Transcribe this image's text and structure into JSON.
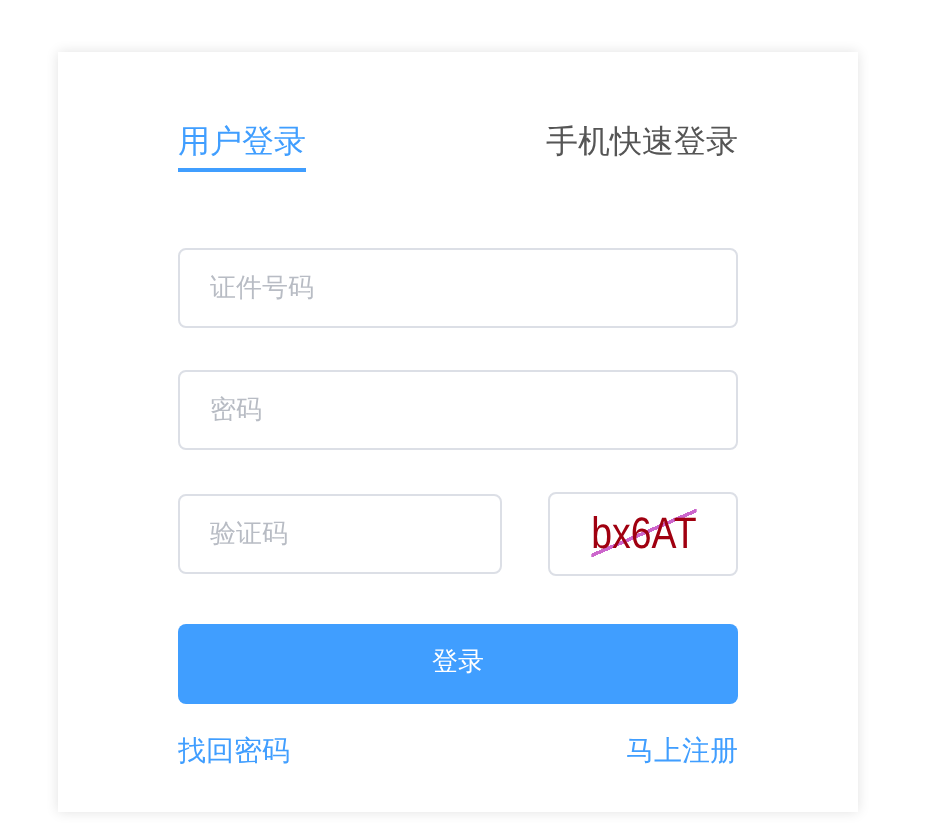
{
  "tabs": [
    {
      "label": "用户登录",
      "selected": true
    },
    {
      "label": "手机快速登录",
      "selected": false
    }
  ],
  "fields": [
    {
      "placeholder": "证件号码"
    },
    {
      "placeholder": "密码"
    }
  ],
  "captcha": {
    "placeholder": "验证码",
    "code": "bx6AT"
  },
  "login_button": "登录",
  "links": [
    "找回密码",
    "马上注册"
  ]
}
